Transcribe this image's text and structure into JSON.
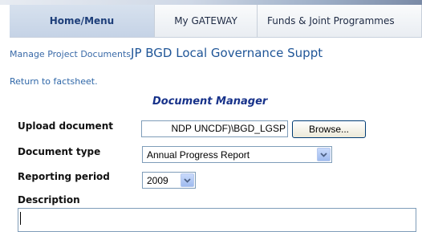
{
  "tabs": [
    {
      "label": "Home/Menu",
      "active": true
    },
    {
      "label": "My GATEWAY",
      "active": false
    },
    {
      "label": "Funds & Joint Programmes",
      "active": false
    }
  ],
  "breadcrumb": {
    "link": "Manage Project Documents",
    "title": "JP BGD Local Governance Suppt"
  },
  "return_link": "Return to factsheet.",
  "document_manager": {
    "title": "Document Manager",
    "upload_label": "Upload document",
    "upload_value": "NDP UNCDF)\\BGD_LGSP",
    "browse_label": "Browse...",
    "type_label": "Document type",
    "type_value": "Annual Progress Report",
    "period_label": "Reporting period",
    "period_value": "2009",
    "description_label": "Description",
    "description_value": ""
  },
  "colors": {
    "link": "#2f67a8",
    "title": "#17328a",
    "active_tab": "#1d3e79"
  }
}
